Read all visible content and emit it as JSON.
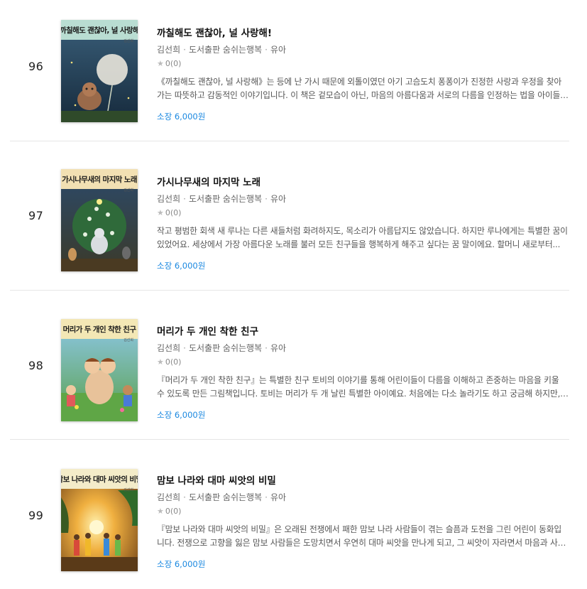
{
  "books": [
    {
      "rank": "96",
      "cover_title": "까칠해도 괜찮아, 널 사랑해",
      "cover_author": "김선희",
      "cover_bg": "#1f3a56",
      "cover_band": "#b9ddd2",
      "title": "까칠해도 괜찮아, 널 사랑해!",
      "author": "김선희",
      "publisher": "도서출판 숨쉬는행복",
      "category": "유아",
      "rating": "0(0)",
      "description": "《까칠해도 괜찮아, 널 사랑해》는 등에 난 가시 때문에 외톨이였던 아기 고슴도치 퐁퐁이가 진정한 사랑과 우정을 찾아가는 따뜻하고 감동적인 이야기입니다. 이 책은 겉모습이 아닌, 마음의 아름다움과 서로의 다름을 인정하는 법을 아이들의 눈높이...",
      "price": "소장 6,000원"
    },
    {
      "rank": "97",
      "cover_title": "가시나무새의 마지막 노래",
      "cover_author": "김선희",
      "cover_bg": "#2c4a3a",
      "cover_band": "#f2e0b3",
      "title": "가시나무새의 마지막 노래",
      "author": "김선희",
      "publisher": "도서출판 숨쉬는행복",
      "category": "유아",
      "rating": "0(0)",
      "description": "작고 평범한 회색 새 루나는 다른 새들처럼 화려하지도, 목소리가 아름답지도 않았습니다. 하지만 루나에게는 특별한 꿈이 있었어요. 세상에서 가장 아름다운 노래를 불러 모든 친구들을 행복하게 해주고 싶다는 꿈 말이에요. 할머니 새로부터...",
      "price": "소장 6,000원"
    },
    {
      "rank": "98",
      "cover_title": "머리가 두 개인 착한 친구",
      "cover_author": "김선희",
      "cover_bg": "#5a9a3c",
      "cover_band": "#f3e7b5",
      "title": "머리가 두 개인 착한 친구",
      "author": "김선희",
      "publisher": "도서출판 숨쉬는행복",
      "category": "유아",
      "rating": "0(0)",
      "description": "『머리가 두 개인 착한 친구』는 특별한 친구 토비의 이야기를 통해 어린이들이 다름을 이해하고 존중하는 마음을 키울 수 있도록 만든 그림책입니다. 토비는 머리가 두 개 날린 특별한 아이예요. 처음에는 다소 놀라기도 하고 궁금해 하지만, 곧 그의...",
      "price": "소장 6,000원"
    },
    {
      "rank": "99",
      "cover_title": "맘보 나라와 대마 씨앗의 비밀",
      "cover_author": "김선희",
      "cover_bg": "#c8782a",
      "cover_band": "#f4ecc9",
      "title": "맘보 나라와 대마 씨앗의 비밀",
      "author": "김선희",
      "publisher": "도서출판 숨쉬는행복",
      "category": "유아",
      "rating": "0(0)",
      "description": "『맘보 나라와 대마 씨앗의 비밀』은 오래된 전쟁에서 패한 맘보 나라 사람들이 겪는 슬픔과 도전을 그린 어린이 동화입니다. 전쟁으로 고향을 잃은 맘보 사람들은 도망치면서 우연히 대마 씨앗을 만나게 되고, 그 씨앗이 자라면서 마음과 사람들에게...",
      "price": "소장 6,000원"
    }
  ]
}
